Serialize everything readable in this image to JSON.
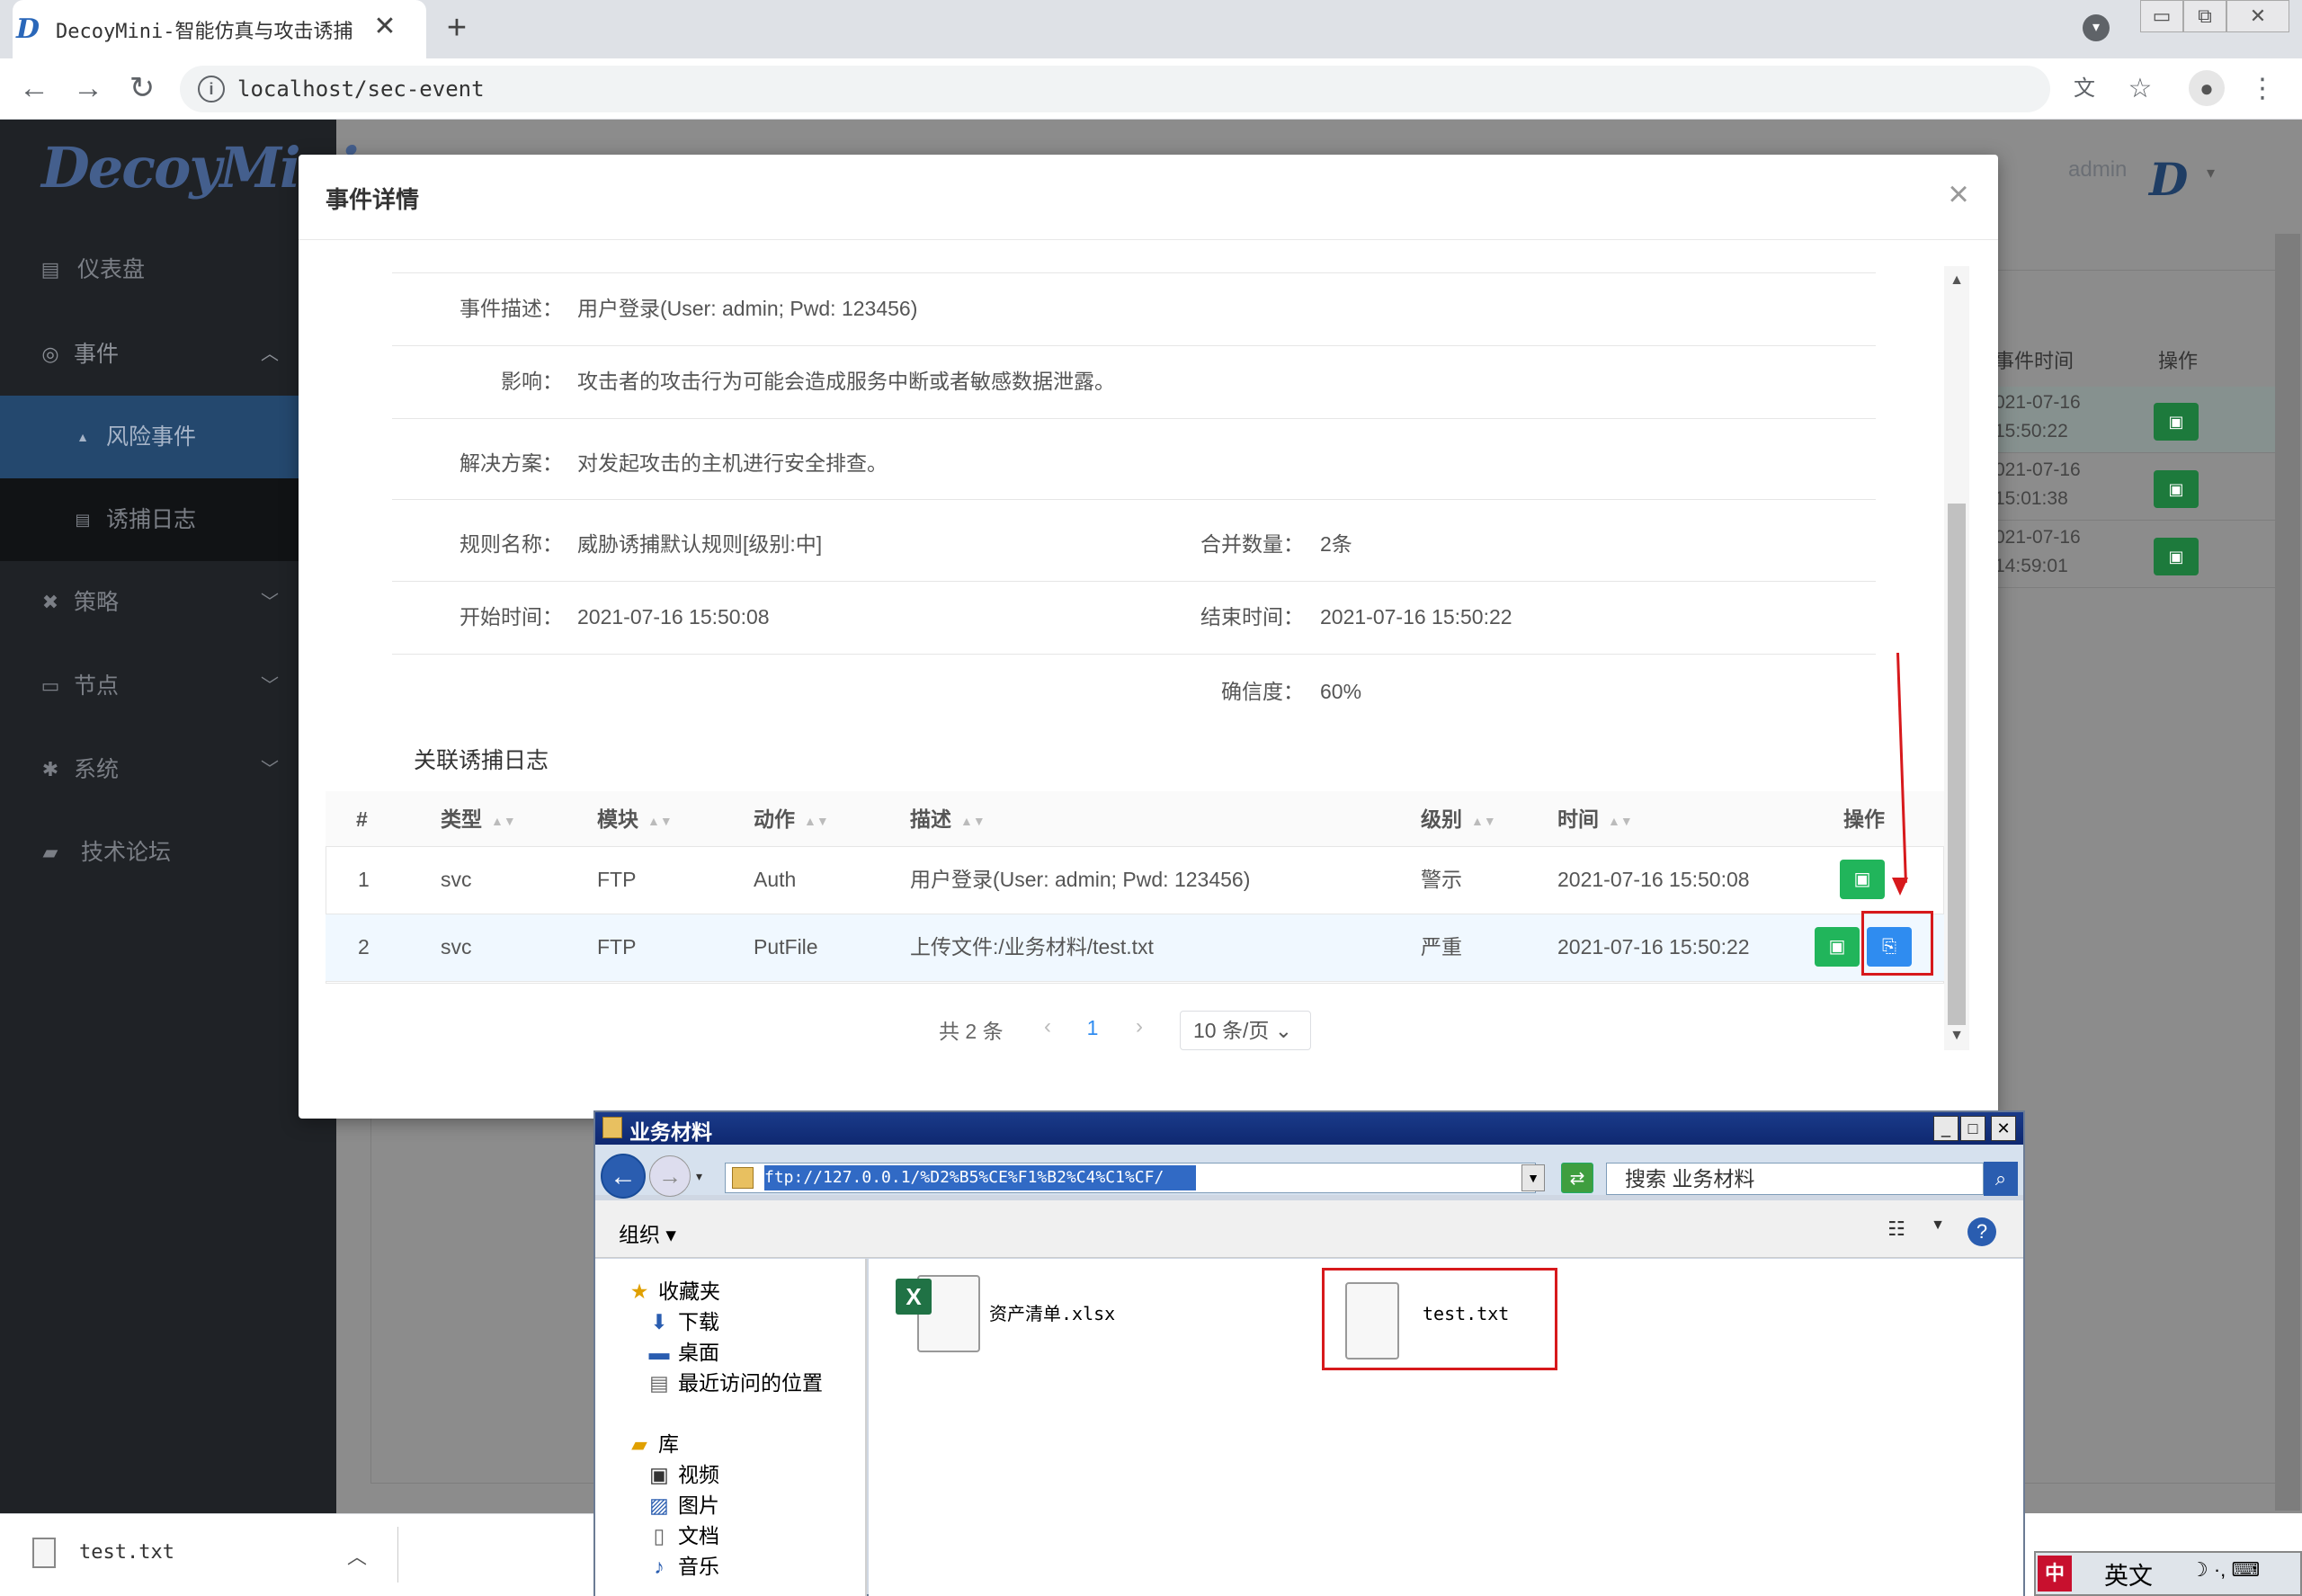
{
  "browser": {
    "tab_title": "DecoyMini-智能仿真与攻击诱捕",
    "tab_favicon": "D",
    "tab_close": "✕",
    "new_tab": "+",
    "url": "localhost/sec-event",
    "icons": [
      "back-arrow-icon",
      "forward-arrow-icon",
      "reload-icon",
      "info-icon",
      "translate-icon",
      "star-icon",
      "account-icon",
      "more-vert-icon"
    ]
  },
  "sidebar": {
    "logo": "DecoyMini",
    "items": [
      {
        "label": "仪表盘",
        "icon": "▤"
      },
      {
        "label": "事件",
        "icon": "◎",
        "arrow": "︿"
      },
      {
        "label": "风险事件",
        "icon": "▲"
      },
      {
        "label": "诱捕日志",
        "icon": "▤"
      },
      {
        "label": "策略",
        "icon": "✖",
        "arrow": "﹀"
      },
      {
        "label": "节点",
        "icon": "▭",
        "arrow": "﹀"
      },
      {
        "label": "系统",
        "icon": "✱",
        "arrow": "﹀"
      },
      {
        "label": "技术论坛",
        "icon": "▰"
      }
    ]
  },
  "header": {
    "user": "admin",
    "logo": "D",
    "caret": "▾"
  },
  "background_table": {
    "headers": [
      "事件时间",
      "操作"
    ],
    "rows": [
      {
        "time_line1": "021-07-16",
        "time_line2": "15:50:22"
      },
      {
        "time_line1": "021-07-16",
        "time_line2": "15:01:38"
      },
      {
        "time_line1": "021-07-16",
        "time_line2": "14:59:01"
      }
    ]
  },
  "modal": {
    "title": "事件详情",
    "close": "×",
    "fields": {
      "desc_label": "事件描述：",
      "desc_value": "用户登录(User: admin; Pwd: 123456)",
      "impact_label": "影响：",
      "impact_value": "攻击者的攻击行为可能会造成服务中断或者敏感数据泄露。",
      "solution_label": "解决方案：",
      "solution_value": "对发起攻击的主机进行安全排查。",
      "rule_label": "规则名称：",
      "rule_value": "威胁诱捕默认规则[级别:中]",
      "merge_label": "合并数量：",
      "merge_value": "2条",
      "start_label": "开始时间：",
      "start_value": "2021-07-16 15:50:08",
      "end_label": "结束时间：",
      "end_value": "2021-07-16 15:50:22",
      "conf_label": "确信度：",
      "conf_value": "60%"
    },
    "section_title": "关联诱捕日志",
    "table": {
      "headers": {
        "num": "#",
        "type": "类型",
        "module": "模块",
        "action": "动作",
        "desc": "描述",
        "level": "级别",
        "time": "时间",
        "op": "操作"
      },
      "rows": [
        {
          "num": "1",
          "type": "svc",
          "module": "FTP",
          "action": "Auth",
          "desc": "用户登录(User: admin; Pwd: 123456)",
          "level": "警示",
          "time": "2021-07-16 15:50:08"
        },
        {
          "num": "2",
          "type": "svc",
          "module": "FTP",
          "action": "PutFile",
          "desc": "上传文件:/业务材料/test.txt",
          "level": "严重",
          "time": "2021-07-16 15:50:22"
        }
      ]
    },
    "pager": {
      "total": "共 2 条",
      "prev": "‹",
      "page": "1",
      "next": "›",
      "size": "10 条/页"
    }
  },
  "explorer": {
    "title": "业务材料",
    "address": "ftp://127.0.0.1/%D2%B5%CE%F1%B2%C4%C1%CF/",
    "search_placeholder": "搜索 业务材料",
    "organize": "组织 ▾",
    "nav": {
      "favorites": "收藏夹",
      "downloads": "下载",
      "desktop": "桌面",
      "recent": "最近访问的位置",
      "libraries": "库",
      "videos": "视频",
      "pictures": "图片",
      "documents": "文档",
      "music": "音乐"
    },
    "files": [
      {
        "name": "资产清单.xlsx"
      },
      {
        "name": "test.txt"
      }
    ],
    "ctrl": {
      "min": "_",
      "max": "□",
      "close": "✕"
    }
  },
  "download_shelf": {
    "file": "test.txt",
    "caret": "︿"
  },
  "ime": {
    "mode": "英文",
    "logo": "中",
    "icons": "☽ ·, ⌨"
  },
  "colors": {
    "accent_blue": "#2f8cf0",
    "accent_green": "#21b55b",
    "highlight_red": "#d7191c",
    "sidebar_bg": "#1f2226"
  }
}
